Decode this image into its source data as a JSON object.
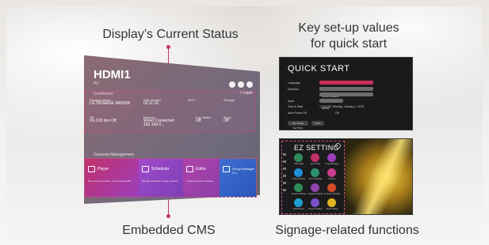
{
  "captions": {
    "status": "Display’s Current Status",
    "setup": "Key set-up values\nfor quick start",
    "cms": "Embedded CMS",
    "signage": "Signage-related functions"
  },
  "display": {
    "input": "HDMI1",
    "input_sub": "PC",
    "dashboard_label": "Dashboard",
    "time": "7:14pm",
    "status_items": [
      {
        "label": "Signage Name",
        "value": "LG SIGNAGE WM3DB"
      },
      {
        "label": "S/W Version",
        "value": "03.11.16"
      },
      {
        "label": "Wi-Fi",
        "value": ""
      },
      {
        "label": "Storage",
        "value": ""
      },
      {
        "label": "Off",
        "value": "On 100 dev Off"
      },
      {
        "label": "Network",
        "value": "Wired Connected 192.168.0..."
      },
      {
        "label": "Fan Status",
        "value": "Off"
      },
      {
        "label": "Temp",
        "value": "Off"
      }
    ],
    "cms_label": "Contents Management",
    "cms_tiles": [
      {
        "label": "Player",
        "desc": "Play various contents, and create playlist."
      },
      {
        "label": "Scheduler",
        "desc": "Manage schedule to play contents."
      },
      {
        "label": "Group Manager 2.0",
        "desc": ""
      },
      {
        "label": "Editor",
        "desc": "Create and edit templates."
      }
    ]
  },
  "quick_start": {
    "title": "QUICK START",
    "rows": [
      {
        "label": "Language",
        "value": "English"
      },
      {
        "label": "Direction",
        "value": "Screen Rotation"
      },
      {
        "label": "Input",
        "value": "HDMI1"
      },
      {
        "label": "Time & Date",
        "value": "12:00 AM, Monday, January 1, 2018"
      },
      {
        "label": "Auto Power Off",
        "value": "Off"
      }
    ],
    "buttons": [
      "GO TO EZ SETTING",
      "Done"
    ]
  },
  "ez_setting": {
    "title": "EZ SETTING",
    "icons": [
      {
        "name": "Video Wall",
        "color": "#2e8b57"
      },
      {
        "name": "Sync Mode",
        "color": "#c2306a"
      },
      {
        "name": "Group Manager",
        "color": "#9b3fbd"
      },
      {
        "name": "Power Saving",
        "color": "#1f8fd6"
      },
      {
        "name": "Server Settings",
        "color": "#2f8f6f"
      },
      {
        "name": "Failover",
        "color": "#c83d8b"
      },
      {
        "name": "Content Settings",
        "color": "#2e8b57"
      },
      {
        "name": "Signage Settings",
        "color": "#8e44ad"
      },
      {
        "name": "SI Server Settings",
        "color": "#d24e2a"
      },
      {
        "name": "Multi Screen",
        "color": "#1d9fd0"
      },
      {
        "name": "Screen Rotation",
        "color": "#7b4fc7"
      },
      {
        "name": "Music Setting",
        "color": "#e0b41e"
      }
    ]
  },
  "colors": {
    "accent": "#c8336e"
  }
}
